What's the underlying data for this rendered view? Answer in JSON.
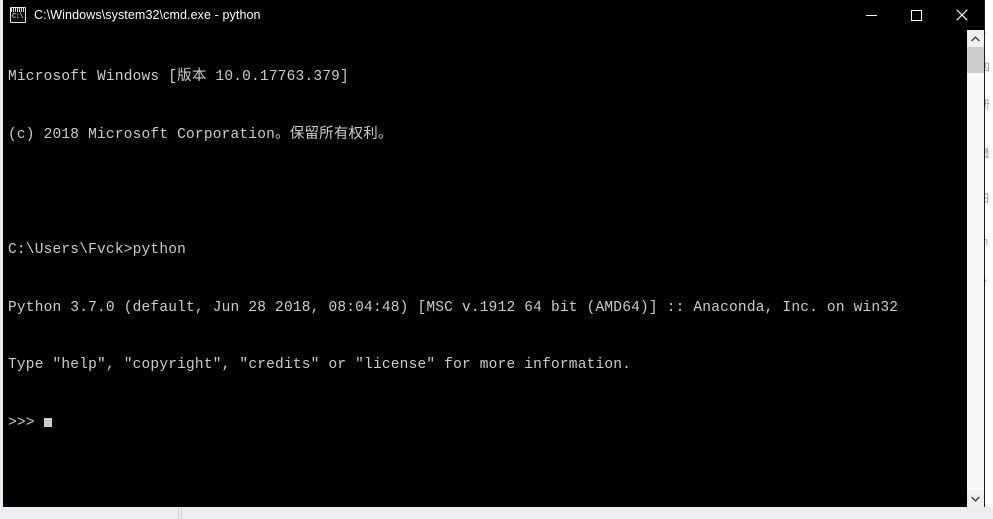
{
  "window": {
    "title": "C:\\Windows\\system32\\cmd.exe - python",
    "icon": "cmd-console-icon",
    "icon_prompt_text": "C:\\",
    "controls": {
      "minimize_label": "Minimize",
      "maximize_label": "Maximize",
      "close_label": "Close"
    }
  },
  "terminal": {
    "lines": [
      "Microsoft Windows [版本 10.0.17763.379]",
      "(c) 2018 Microsoft Corporation。保留所有权利。",
      "",
      "C:\\Users\\Fvck>python",
      "Python 3.7.0 (default, Jun 28 2018, 08:04:48) [MSC v.1912 64 bit (AMD64)] :: Anaconda, Inc. on win32",
      "Type \"help\", \"copyright\", \"credits\" or \"license\" for more information.",
      ">>>"
    ],
    "prompt": ">>>",
    "cursor": "block",
    "foreground_color": "#cccccc",
    "background_color": "#000000"
  },
  "scrollbar": {
    "up_arrow": "chevron-up-icon",
    "down_arrow": "chevron-down-icon",
    "thumb_position_percent": 0,
    "thumb_size_percent": 6
  },
  "background": {
    "right_panel_lines": [
      "y",
      "四",
      "册",
      "量",
      "日",
      "m",
      "A"
    ],
    "bottom_strip_text": ""
  }
}
